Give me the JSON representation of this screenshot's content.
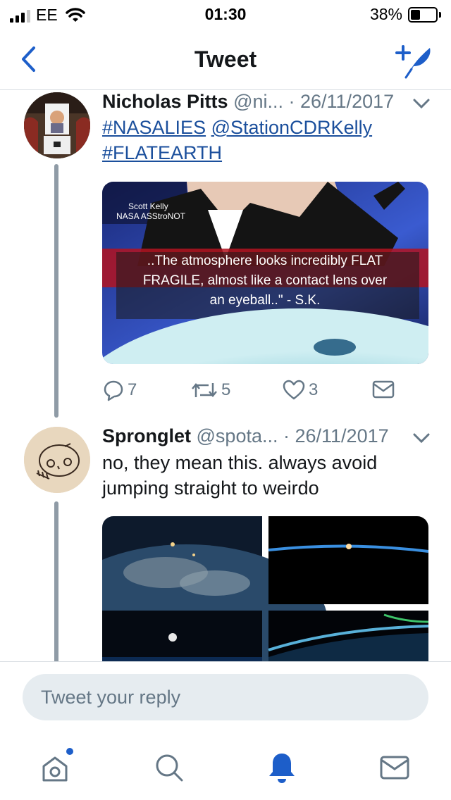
{
  "status_bar": {
    "carrier": "EE",
    "time": "01:30",
    "battery": "38%",
    "battery_level": 0.38
  },
  "navbar": {
    "title": "Tweet",
    "back_icon": "chevron-left-icon",
    "compose_icon": "compose-tweet-icon"
  },
  "tweets": [
    {
      "name": "Nicholas Pitts",
      "handle": "@ni...",
      "sep": " · ",
      "date": "26/11/2017",
      "text_links": [
        "#NASALIES",
        "@StationCDRKelly",
        "#FLATEARTH"
      ],
      "image": {
        "label_line1": "Scott Kelly",
        "label_line2": "NASA ASStroNOT",
        "caption_line1": "..The atmosphere looks incredibly FLAT",
        "caption_line2": "FRAGILE, almost like a contact lens over",
        "caption_line3": "an eyeball..\" - S.K."
      },
      "actions": {
        "replies": "7",
        "retweets": "5",
        "likes": "3"
      }
    },
    {
      "name": "Spronglet",
      "handle": "@spota...",
      "sep": " · ",
      "date": "26/11/2017",
      "text_line1": "no, they mean this. always avoid",
      "text_line2": "jumping straight to weirdo"
    }
  ],
  "reply": {
    "placeholder": "Tweet your reply"
  },
  "tabbar": {
    "items": [
      "home-icon",
      "search-icon",
      "notifications-icon",
      "messages-icon"
    ],
    "active": "notifications-icon"
  },
  "colors": {
    "accent": "#1d5ec9",
    "link": "#1b4f9c",
    "secondary_text": "#657786",
    "thread_line": "#8f9ba6"
  }
}
